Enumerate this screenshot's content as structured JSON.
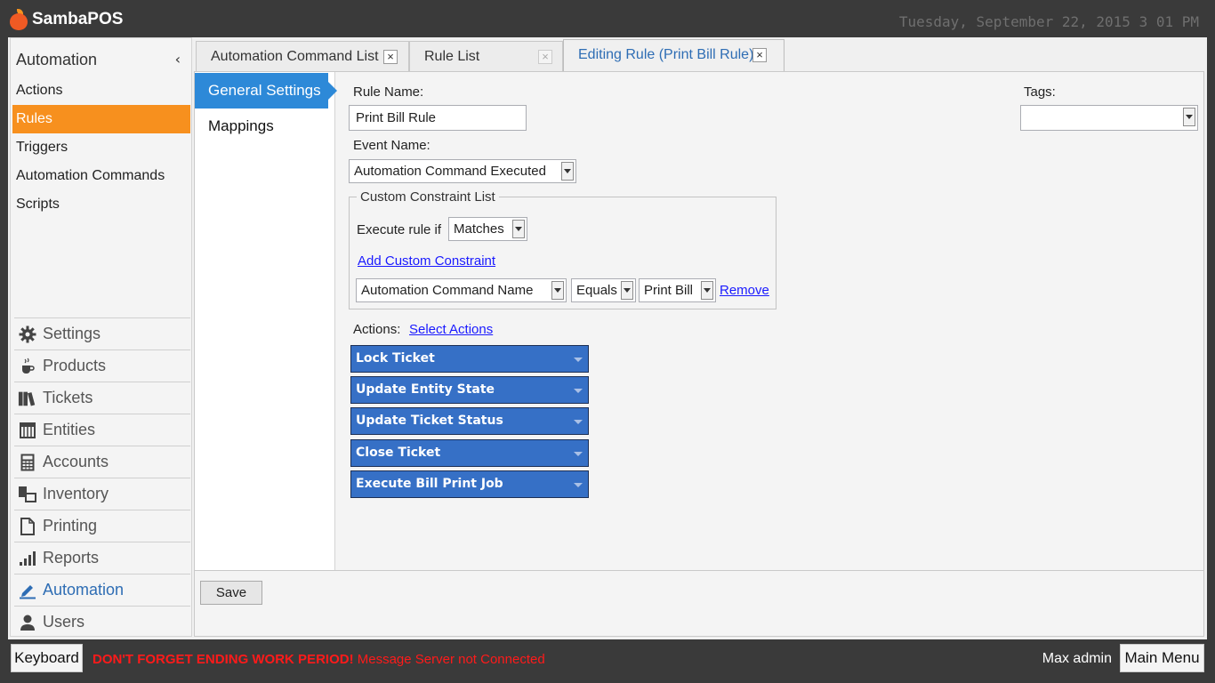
{
  "app": {
    "title": "SambaPOS",
    "datetime": "Tuesday, September 22, 2015 3 01 PM"
  },
  "sidebar": {
    "header": "Automation",
    "collapse_icon": "chevron-left-icon",
    "items": [
      {
        "label": "Actions"
      },
      {
        "label": "Rules",
        "active": true
      },
      {
        "label": "Triggers"
      },
      {
        "label": "Automation Commands"
      },
      {
        "label": "Scripts"
      }
    ],
    "modules": [
      {
        "label": "Settings",
        "icon": "gear-icon"
      },
      {
        "label": "Products",
        "icon": "coffee-icon"
      },
      {
        "label": "Tickets",
        "icon": "books-icon"
      },
      {
        "label": "Entities",
        "icon": "grid-icon"
      },
      {
        "label": "Accounts",
        "icon": "calculator-icon"
      },
      {
        "label": "Inventory",
        "icon": "inventory-icon"
      },
      {
        "label": "Printing",
        "icon": "document-icon"
      },
      {
        "label": "Reports",
        "icon": "bar-chart-icon"
      },
      {
        "label": "Automation",
        "icon": "pencil-icon",
        "active": true
      },
      {
        "label": "Users",
        "icon": "user-icon"
      }
    ]
  },
  "tabs": [
    {
      "label": "Automation Command List",
      "close": "×"
    },
    {
      "label": "Rule List",
      "close": "×"
    },
    {
      "label": "Editing Rule (Print Bill Rule)",
      "close": "×",
      "active": true
    }
  ],
  "subnav": [
    {
      "label": "General Settings",
      "active": true
    },
    {
      "label": "Mappings"
    }
  ],
  "form": {
    "rule_name_label": "Rule Name:",
    "rule_name_value": "Print Bill Rule",
    "event_name_label": "Event Name:",
    "event_name_value": "Automation Command Executed",
    "tags_label": "Tags:",
    "tags_value": "",
    "constraints": {
      "legend": "Custom Constraint List",
      "execute_label": "Execute rule if",
      "execute_value": "Matches",
      "add_link": "Add Custom Constraint",
      "row": {
        "field": "Automation Command Name",
        "operator": "Equals",
        "value": "Print Bill",
        "remove_link": "Remove"
      }
    },
    "actions_label": "Actions:",
    "select_actions_link": "Select Actions",
    "actions": [
      "Lock Ticket",
      "Update Entity State",
      "Update Ticket Status",
      "Close Ticket",
      "Execute Bill Print Job"
    ],
    "save_label": "Save"
  },
  "footer": {
    "keyboard_label": "Keyboard",
    "warning_bold": "DON'T FORGET ENDING WORK PERIOD!",
    "warning_text": " Message Server not Connected",
    "user": "Max admin",
    "main_menu_label": "Main Menu"
  },
  "colors": {
    "accent_orange": "#f7901e",
    "selection_blue": "#2d89d8",
    "action_blue": "#3670c6",
    "warning_red": "#ff1a1a"
  }
}
